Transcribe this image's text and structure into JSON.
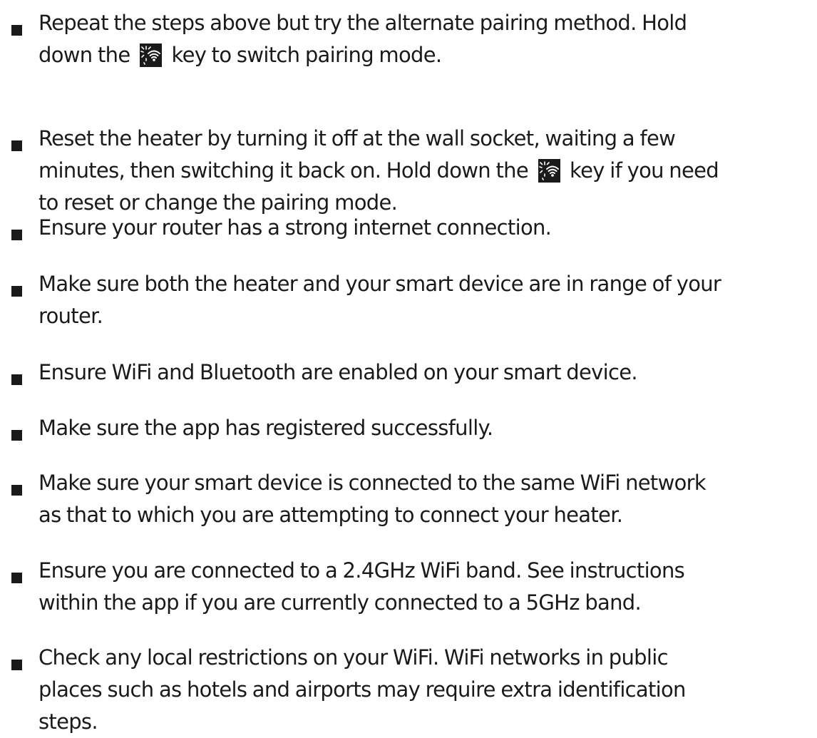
{
  "troubleshooting": {
    "key_icon": "wifi-pairing-key-icon",
    "items": [
      {
        "lines": [
          [
            "Repeat the steps above but try the alternate pairing method. Hold"
          ],
          [
            "down the ",
            "{icon}",
            " key to switch pairing mode."
          ]
        ]
      },
      {
        "lines": [
          [
            "Reset the heater by turning it off at the wall socket, waiting a few"
          ],
          [
            "minutes, then switching it back on. Hold down the ",
            "{icon}",
            " key if you need"
          ],
          [
            "to reset or change the pairing mode."
          ]
        ]
      },
      {
        "lines": [
          [
            "Ensure your router has a strong internet connection."
          ]
        ]
      },
      {
        "lines": [
          [
            "Make sure both the heater and your smart device are in range of your"
          ],
          [
            "router."
          ]
        ]
      },
      {
        "lines": [
          [
            "Ensure WiFi and Bluetooth are enabled on your smart device."
          ]
        ]
      },
      {
        "lines": [
          [
            "Make sure the app has registered successfully."
          ]
        ]
      },
      {
        "lines": [
          [
            "Make sure your smart device is connected to the same WiFi network"
          ],
          [
            "as that to which you are attempting to connect your heater."
          ]
        ]
      },
      {
        "lines": [
          [
            "Ensure you are connected to a 2.4GHz WiFi band. See instructions"
          ],
          [
            "within the app if you are currently connected to a 5GHz band."
          ]
        ]
      },
      {
        "lines": [
          [
            "Check any local restrictions on your WiFi. WiFi networks in public"
          ],
          [
            "places such as hotels and airports may require extra identification"
          ],
          [
            "steps."
          ]
        ]
      }
    ]
  }
}
